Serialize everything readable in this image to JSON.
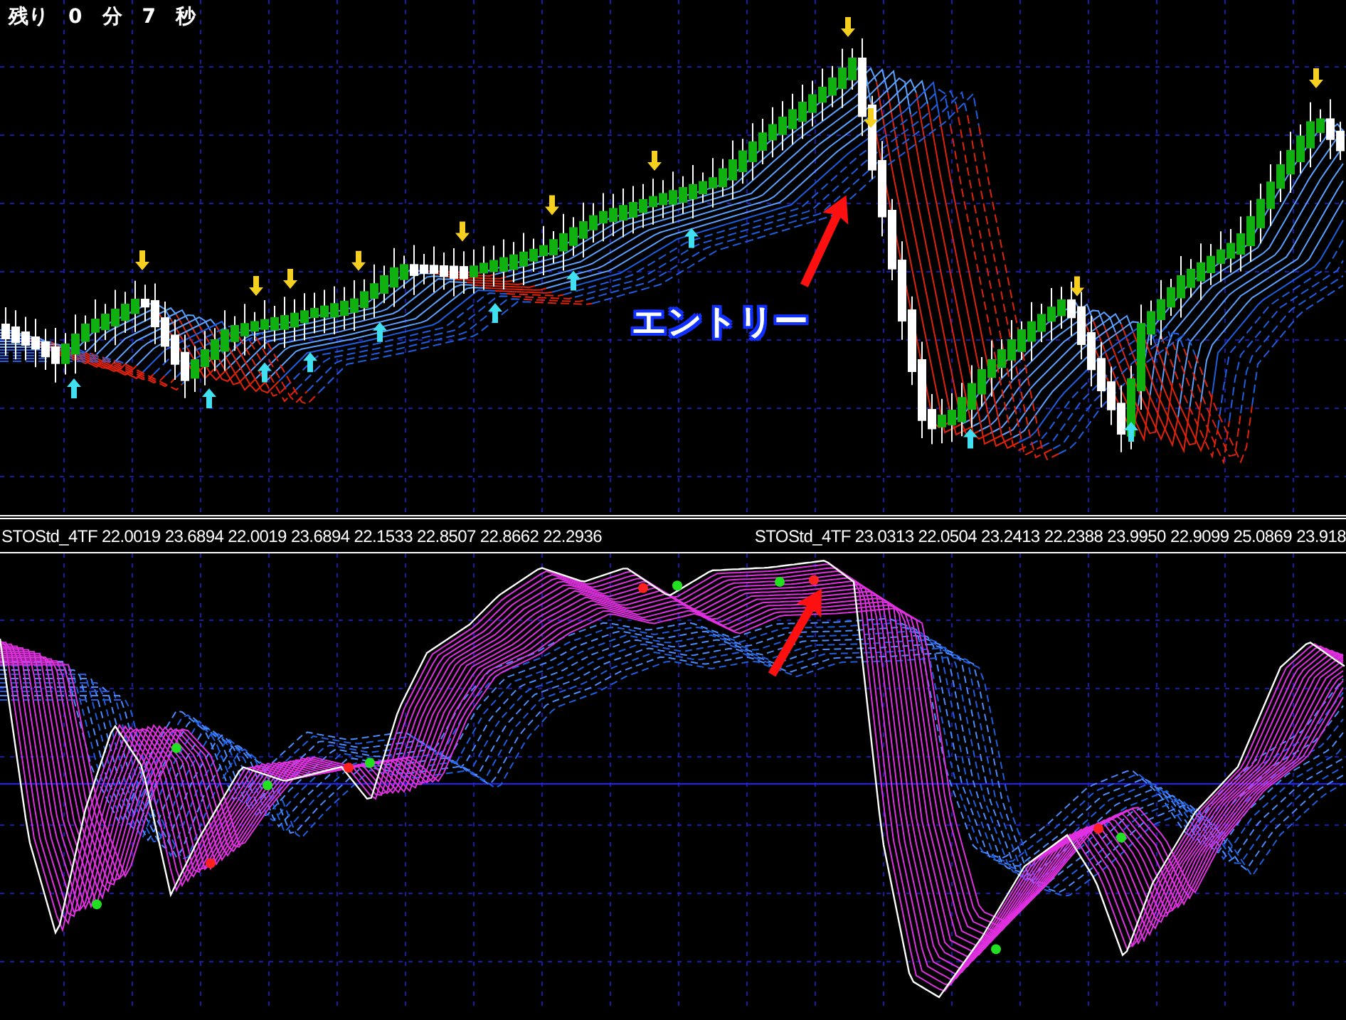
{
  "countdown": {
    "label": "残り",
    "minutes": "0",
    "minutes_unit": "分",
    "seconds": "7",
    "seconds_unit": "秒"
  },
  "annotation": {
    "text": "エントリー"
  },
  "indicator_bar": [
    "STOStd_4TF 22.0019 23.6894 22.0019 23.6894 22.1533 22.8507 22.8662 22.2936",
    "STOStd_4TF 23.0313 22.0504 23.2413 22.2388 23.9950 22.9099 25.0869 23.918"
  ]
}
